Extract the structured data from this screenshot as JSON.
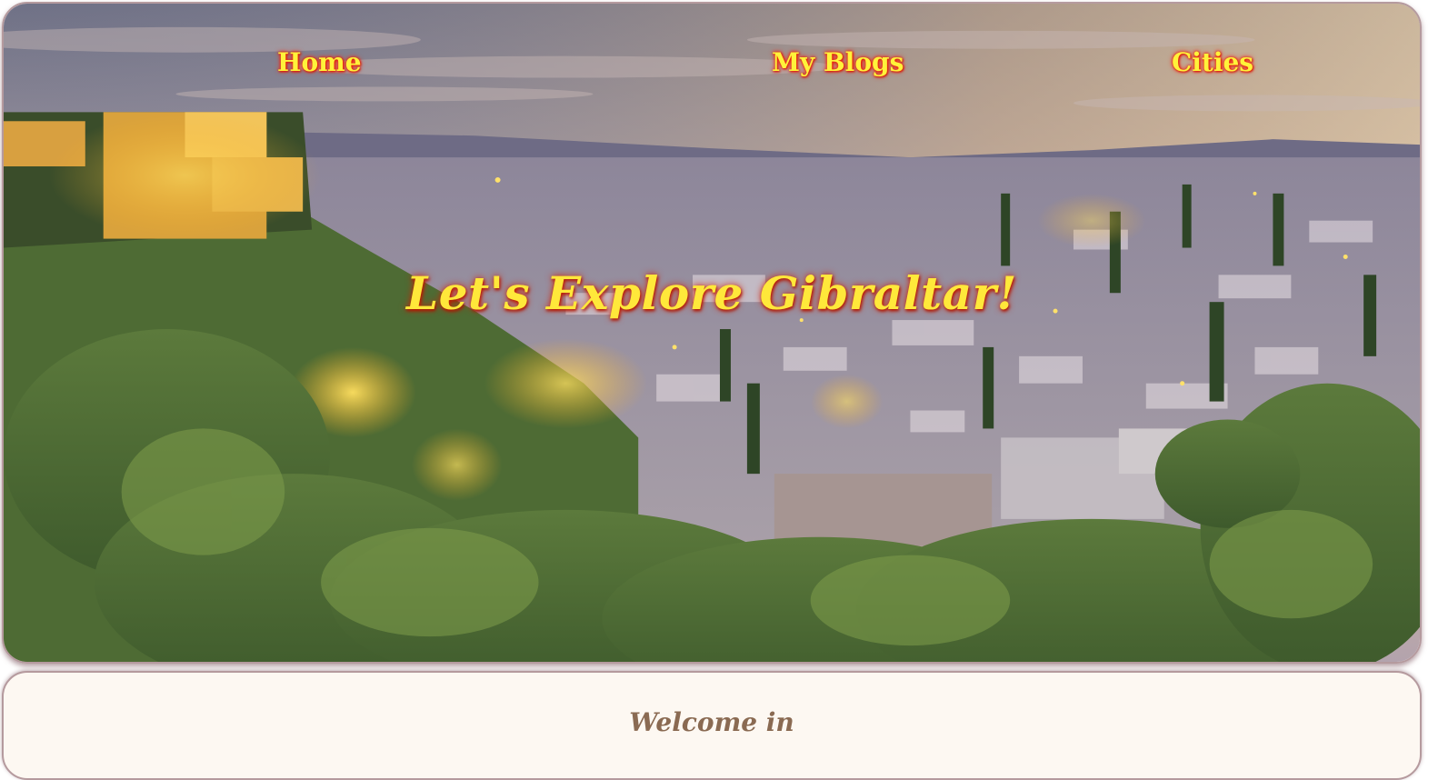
{
  "nav": {
    "home": "Home",
    "blogs": "My Blogs",
    "cities": "Cities"
  },
  "hero": {
    "title": "Let's Explore Gibraltar!"
  },
  "welcome": {
    "heading": "Welcome in"
  },
  "colors": {
    "nav_text": "#fff23a",
    "nav_glow": "#ff2a10",
    "title_text": "#ffe83a",
    "panel_bg": "#fdf8f2",
    "panel_border": "#b59a9e",
    "welcome_text": "#8a6a52"
  }
}
